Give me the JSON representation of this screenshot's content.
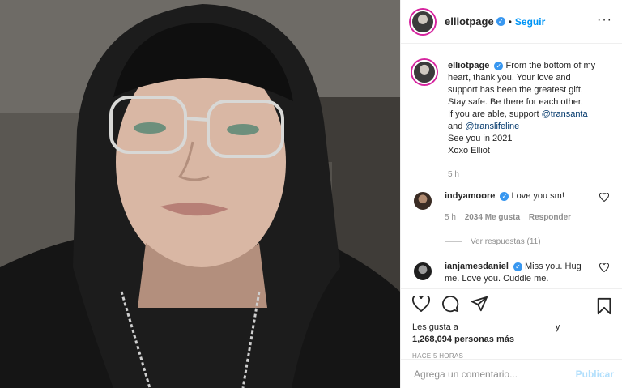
{
  "header": {
    "username": "elliotpage",
    "verified_glyph": "✓",
    "dot": "•",
    "follow_label": "Seguir",
    "more_glyph": "···"
  },
  "caption": {
    "username": "elliotpage",
    "text_1": "From the bottom of my heart, thank you. Your love and support has been the greatest gift.",
    "text_2": "Stay safe. Be there for each other.",
    "text_3": "If you are able, support ",
    "mention_1": "@transanta",
    "text_4": "and ",
    "mention_2": "@translifeline",
    "text_5": "See you in 2021",
    "text_6": "Xoxo Elliot",
    "time": "5 h"
  },
  "comments": [
    {
      "username": "indyamoore",
      "text": "Love you sm!",
      "time": "5 h",
      "likes": "2034 Me gusta",
      "reply_label": "Responder",
      "view_replies": "Ver respuestas (11)"
    },
    {
      "username": "ianjamesdaniel",
      "text": "Miss you. Hug me. Love you. Cuddle me."
    }
  ],
  "likes": {
    "prefix": "Les gusta a",
    "conjunction": "y",
    "count": "1,268,094 personas más"
  },
  "time_ago": "HACE 5 HORAS",
  "comment_box": {
    "placeholder": "Agrega un comentario...",
    "publish_label": "Publicar"
  },
  "icons": {
    "like": "heart-icon",
    "comment": "comment-icon",
    "share": "share-icon",
    "save": "bookmark-icon",
    "comment_like": "small-heart-icon"
  },
  "colors": {
    "link": "#0095f6",
    "mention": "#00376b",
    "verified": "#3897f0",
    "muted": "#8e8e8e",
    "publish_disabled": "#b2dffc"
  }
}
